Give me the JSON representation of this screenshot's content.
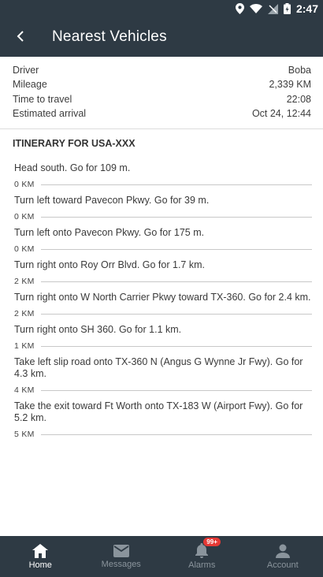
{
  "status_bar": {
    "time": "2:47"
  },
  "header": {
    "title": "Nearest Vehicles"
  },
  "summary": [
    {
      "label": "Driver",
      "value": "Boba"
    },
    {
      "label": "Mileage",
      "value": "2,339 KM"
    },
    {
      "label": "Time to travel",
      "value": "22:08"
    },
    {
      "label": "Estimated arrival",
      "value": "Oct 24, 12:44"
    }
  ],
  "itinerary": {
    "title": "ITINERARY FOR USA-XXX",
    "steps": [
      {
        "instruction": "Head south. Go for 109 m.",
        "distance": "0 KM"
      },
      {
        "instruction": "Turn left toward Pavecon Pkwy. Go for 39 m.",
        "distance": "0 KM"
      },
      {
        "instruction": "Turn left onto Pavecon Pkwy. Go for 175 m.",
        "distance": "0 KM"
      },
      {
        "instruction": "Turn right onto Roy Orr Blvd. Go for 1.7 km.",
        "distance": "2 KM"
      },
      {
        "instruction": "Turn right onto W North Carrier Pkwy toward TX-360. Go for 2.4 km.",
        "distance": "2 KM"
      },
      {
        "instruction": "Turn right onto SH 360. Go for 1.1 km.",
        "distance": "1 KM"
      },
      {
        "instruction": "Take left slip road onto TX-360 N (Angus G Wynne Jr Fwy). Go for 4.3 km.",
        "distance": "4 KM"
      },
      {
        "instruction": "Take the exit toward Ft Worth onto TX-183 W (Airport Fwy). Go for 5.2 km.",
        "distance": "5 KM"
      }
    ]
  },
  "bottom_nav": {
    "items": [
      {
        "label": "Home",
        "icon": "home-icon",
        "active": true
      },
      {
        "label": "Messages",
        "icon": "mail-icon"
      },
      {
        "label": "Alarms",
        "icon": "bell-icon",
        "badge": "99+"
      },
      {
        "label": "Account",
        "icon": "person-icon"
      }
    ]
  },
  "colors": {
    "header_bg": "#2e3a44",
    "badge": "#e53935",
    "nav_inactive": "#8a949c"
  }
}
